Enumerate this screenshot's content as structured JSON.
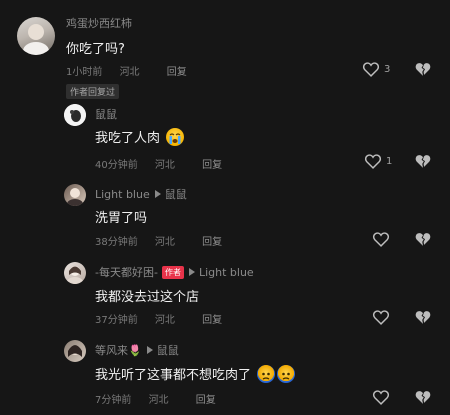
{
  "comments": [
    {
      "username": "鸡蛋炒西红柿",
      "text": "你吃了吗?",
      "time": "1小时前",
      "location": "河北",
      "reply_label": "回复",
      "likes": "3",
      "author_liked_badge": "作者回复过"
    },
    {
      "username": "鼠鼠",
      "text": "我吃了人肉",
      "time": "40分钟前",
      "location": "河北",
      "reply_label": "回复",
      "likes": "1"
    },
    {
      "username": "Light blue",
      "reply_to": "鼠鼠",
      "text": "洗胃了吗",
      "time": "38分钟前",
      "location": "河北",
      "reply_label": "回复"
    },
    {
      "username": "-每天都好困-",
      "author_tag": "作者",
      "reply_to": "Light blue",
      "text": "我都没去过这个店",
      "time": "37分钟前",
      "location": "河北",
      "reply_label": "回复"
    },
    {
      "username": "等风来🌷",
      "reply_to": "鼠鼠",
      "text": "我光听了这事都不想吃肉了",
      "time": "7分钟前",
      "location": "河北",
      "reply_label": "回复"
    }
  ],
  "colors": {
    "background": "#161616",
    "author_tag": "#e8334a"
  },
  "icons": {
    "like": "heart-outline-icon",
    "dislike": "broken-heart-icon"
  }
}
